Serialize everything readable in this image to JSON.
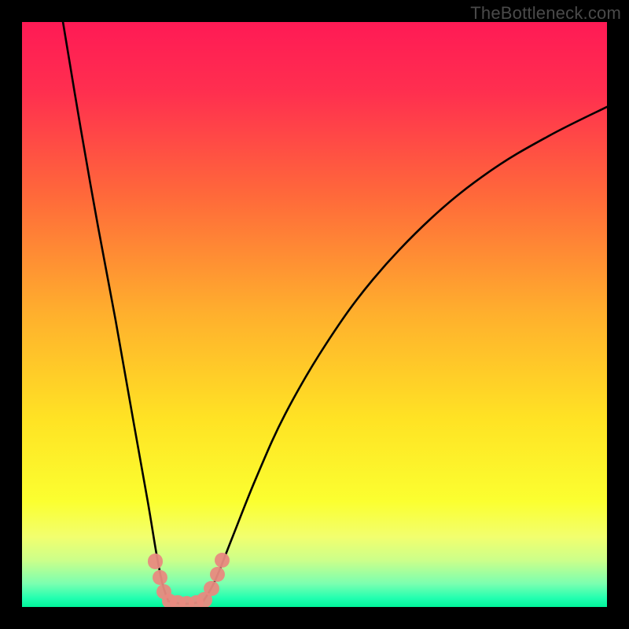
{
  "watermark": "TheBottleneck.com",
  "chart_data": {
    "type": "line",
    "title": "",
    "xlabel": "",
    "ylabel": "",
    "xlim": [
      0,
      100
    ],
    "ylim": [
      0,
      100
    ],
    "gradient_stops": [
      {
        "offset": 0.0,
        "color": "#ff1a55"
      },
      {
        "offset": 0.12,
        "color": "#ff2f4f"
      },
      {
        "offset": 0.3,
        "color": "#ff6a3a"
      },
      {
        "offset": 0.5,
        "color": "#ffb02d"
      },
      {
        "offset": 0.68,
        "color": "#ffe324"
      },
      {
        "offset": 0.82,
        "color": "#fbff30"
      },
      {
        "offset": 0.88,
        "color": "#f2ff6e"
      },
      {
        "offset": 0.92,
        "color": "#ccff8a"
      },
      {
        "offset": 0.96,
        "color": "#7bffb0"
      },
      {
        "offset": 0.985,
        "color": "#22ffb0"
      },
      {
        "offset": 1.0,
        "color": "#00f59a"
      }
    ],
    "series": [
      {
        "name": "left-branch",
        "points": [
          {
            "x": 7.0,
            "y": 100.0
          },
          {
            "x": 10.0,
            "y": 82.0
          },
          {
            "x": 13.0,
            "y": 65.0
          },
          {
            "x": 16.0,
            "y": 49.0
          },
          {
            "x": 19.0,
            "y": 32.0
          },
          {
            "x": 21.5,
            "y": 18.0
          },
          {
            "x": 23.0,
            "y": 9.0
          },
          {
            "x": 24.0,
            "y": 4.0
          },
          {
            "x": 25.0,
            "y": 1.0
          }
        ]
      },
      {
        "name": "valley-floor",
        "points": [
          {
            "x": 25.0,
            "y": 1.0
          },
          {
            "x": 27.0,
            "y": 0.6
          },
          {
            "x": 29.0,
            "y": 0.6
          },
          {
            "x": 31.0,
            "y": 1.0
          }
        ]
      },
      {
        "name": "right-branch",
        "points": [
          {
            "x": 31.0,
            "y": 1.0
          },
          {
            "x": 33.0,
            "y": 4.5
          },
          {
            "x": 36.0,
            "y": 12.0
          },
          {
            "x": 40.0,
            "y": 22.0
          },
          {
            "x": 45.0,
            "y": 33.0
          },
          {
            "x": 52.0,
            "y": 45.0
          },
          {
            "x": 60.0,
            "y": 56.0
          },
          {
            "x": 70.0,
            "y": 66.5
          },
          {
            "x": 80.0,
            "y": 74.5
          },
          {
            "x": 90.0,
            "y": 80.5
          },
          {
            "x": 100.0,
            "y": 85.5
          }
        ]
      }
    ],
    "markers": [
      {
        "x": 22.8,
        "y": 7.8,
        "r": 1.3
      },
      {
        "x": 23.6,
        "y": 5.0,
        "r": 1.3
      },
      {
        "x": 24.3,
        "y": 2.6,
        "r": 1.3
      },
      {
        "x": 25.2,
        "y": 1.0,
        "r": 1.3
      },
      {
        "x": 26.6,
        "y": 0.7,
        "r": 1.3
      },
      {
        "x": 28.2,
        "y": 0.6,
        "r": 1.3
      },
      {
        "x": 29.8,
        "y": 0.7,
        "r": 1.3
      },
      {
        "x": 31.2,
        "y": 1.2,
        "r": 1.3
      },
      {
        "x": 32.4,
        "y": 3.2,
        "r": 1.3
      },
      {
        "x": 33.4,
        "y": 5.6,
        "r": 1.3
      },
      {
        "x": 34.2,
        "y": 8.0,
        "r": 1.3
      }
    ]
  }
}
